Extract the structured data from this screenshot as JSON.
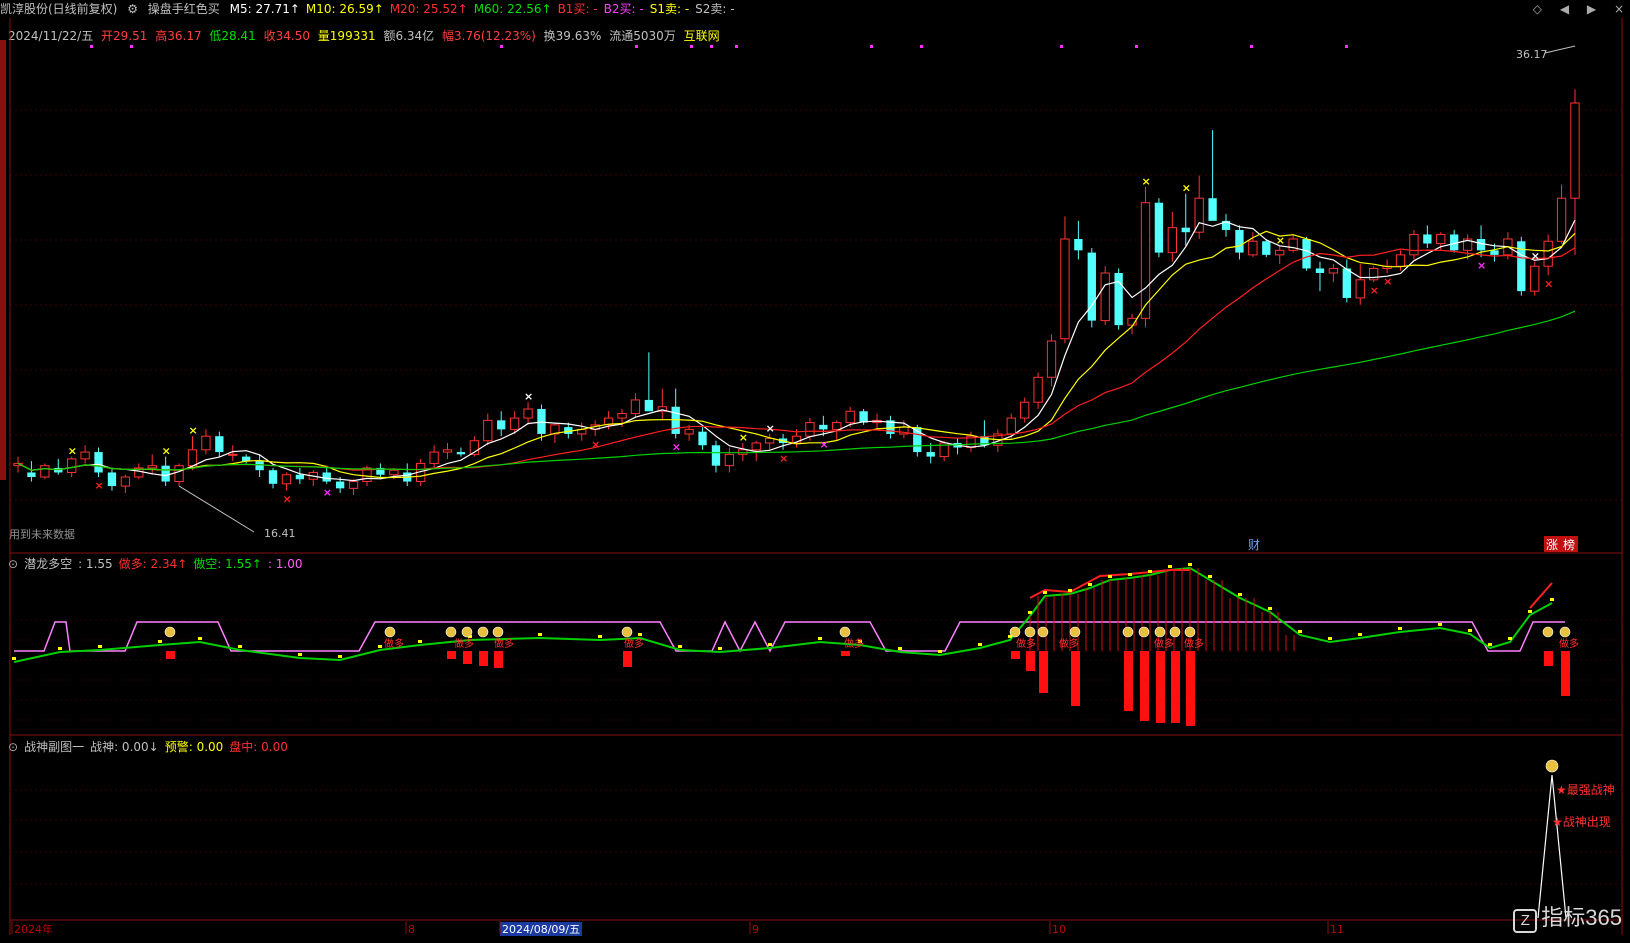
{
  "window": {
    "stock": "凯淳股份(日线前复权)",
    "indicator": "操盘手红色买",
    "ma_labels": [
      {
        "label": "M5: 27.71↑",
        "color": "#ffffff"
      },
      {
        "label": "M10: 26.59↑",
        "color": "#ffff00"
      },
      {
        "label": "M20: 25.52↑",
        "color": "#ff3030"
      },
      {
        "label": "M60: 22.56↑",
        "color": "#00e000"
      },
      {
        "label": "B1买: -",
        "color": "#ff3030"
      },
      {
        "label": "B2买: -",
        "color": "#ff40ff"
      },
      {
        "label": "S1卖: -",
        "color": "#ffff00"
      },
      {
        "label": "S2卖: -",
        "color": "#c0c0c0"
      }
    ],
    "controls": [
      "◇",
      "◀",
      "▶",
      "×"
    ]
  },
  "quote": {
    "date": "2024/11/22/五",
    "open": "开29.51",
    "high": "高36.17",
    "low": "低28.41",
    "close": "收34.50",
    "volume": "量199331",
    "amount": "额6.34亿",
    "change": "幅3.76(12.23%)",
    "turnover": "换39.63%",
    "float": "流通5030万",
    "sector": "互联网"
  },
  "main_chart": {
    "price_high_label": "36.17",
    "price_low_label": "16.41",
    "future_data_note": "用到未来数据",
    "marker_cai": "财",
    "marker_zhang": "涨",
    "marker_bang": "榜"
  },
  "ind1": {
    "name": "潜龙多空",
    "value": ": 1.55",
    "zuoduo": "做多: 2.34↑",
    "zuokong": "做空: 1.55↑",
    "extra": ": 1.00",
    "tag": "做多"
  },
  "ind2": {
    "name": "战神副图一",
    "zhanshen": "战神: 0.00↓",
    "yujing": "预警: 0.00",
    "panzhong": "盘中: 0.00",
    "label_strongest": "★最强战神",
    "label_appear": "★战神出现"
  },
  "time_axis": [
    {
      "label": "2024年",
      "highlight": false
    },
    {
      "label": "8",
      "highlight": false
    },
    {
      "label": "2024/08/09/五",
      "highlight": true
    },
    {
      "label": "9",
      "highlight": false
    },
    {
      "label": "10",
      "highlight": false
    },
    {
      "label": "11",
      "highlight": false
    }
  ],
  "logo": "指标365",
  "chart_data": {
    "type": "candlestick",
    "title": "凯淳股份(日线前复权)",
    "ylim": [
      15,
      37.5
    ],
    "annotations": [
      "36.17",
      "16.41"
    ],
    "series": [
      {
        "name": "K",
        "ohlc": [
          [
            18.5,
            18.9,
            18.2,
            18.6
          ],
          [
            18.2,
            18.7,
            17.8,
            18.0
          ],
          [
            18.0,
            18.6,
            17.9,
            18.5
          ],
          [
            18.4,
            18.8,
            18.1,
            18.2
          ],
          [
            18.2,
            18.9,
            18.0,
            18.8
          ],
          [
            18.8,
            19.4,
            18.6,
            19.1
          ],
          [
            19.1,
            19.3,
            18.0,
            18.2
          ],
          [
            18.2,
            18.4,
            17.4,
            17.6
          ],
          [
            17.6,
            18.1,
            17.3,
            18.0
          ],
          [
            18.0,
            18.6,
            17.9,
            18.4
          ],
          [
            18.4,
            19.0,
            18.1,
            18.5
          ],
          [
            18.5,
            18.9,
            17.6,
            17.8
          ],
          [
            17.8,
            18.6,
            17.6,
            18.5
          ],
          [
            18.5,
            19.8,
            18.3,
            19.2
          ],
          [
            19.2,
            20.1,
            19.0,
            19.8
          ],
          [
            19.8,
            20.0,
            18.9,
            19.1
          ],
          [
            19.0,
            19.4,
            18.7,
            19.0
          ],
          [
            18.9,
            19.0,
            18.6,
            18.7
          ],
          [
            18.7,
            19.0,
            18.0,
            18.3
          ],
          [
            18.3,
            18.4,
            17.5,
            17.7
          ],
          [
            17.7,
            18.2,
            17.4,
            18.1
          ],
          [
            18.1,
            18.4,
            17.7,
            17.9
          ],
          [
            17.9,
            18.3,
            17.6,
            18.2
          ],
          [
            18.2,
            18.5,
            17.7,
            17.8
          ],
          [
            17.8,
            18.0,
            17.3,
            17.5
          ],
          [
            17.5,
            17.9,
            17.2,
            17.8
          ],
          [
            17.8,
            18.5,
            17.6,
            18.4
          ],
          [
            18.4,
            18.6,
            17.9,
            18.1
          ],
          [
            18.1,
            18.4,
            17.9,
            18.3
          ],
          [
            18.2,
            18.6,
            17.6,
            17.8
          ],
          [
            17.8,
            18.8,
            17.6,
            18.6
          ],
          [
            18.6,
            19.4,
            18.4,
            19.1
          ],
          [
            19.1,
            19.5,
            18.8,
            19.2
          ],
          [
            19.1,
            19.3,
            18.9,
            19.0
          ],
          [
            19.0,
            19.8,
            18.9,
            19.6
          ],
          [
            19.6,
            20.8,
            19.4,
            20.5
          ],
          [
            20.5,
            20.9,
            19.8,
            20.1
          ],
          [
            20.1,
            20.9,
            19.9,
            20.6
          ],
          [
            20.6,
            21.3,
            20.3,
            21.0
          ],
          [
            21.0,
            21.2,
            19.6,
            19.9
          ],
          [
            19.9,
            20.4,
            19.5,
            20.3
          ],
          [
            20.2,
            20.4,
            19.7,
            19.9
          ],
          [
            19.9,
            20.4,
            19.6,
            20.1
          ],
          [
            20.1,
            20.5,
            19.8,
            20.3
          ],
          [
            20.3,
            20.9,
            20.1,
            20.6
          ],
          [
            20.6,
            21.0,
            20.2,
            20.8
          ],
          [
            20.8,
            21.7,
            20.6,
            21.4
          ],
          [
            21.4,
            23.5,
            21.0,
            20.9
          ],
          [
            20.9,
            21.9,
            20.5,
            21.1
          ],
          [
            21.1,
            21.9,
            19.7,
            19.9
          ],
          [
            19.9,
            20.3,
            19.6,
            20.1
          ],
          [
            20.0,
            20.2,
            19.2,
            19.4
          ],
          [
            19.4,
            19.6,
            18.2,
            18.5
          ],
          [
            18.5,
            19.3,
            18.2,
            19.0
          ],
          [
            19.0,
            19.5,
            18.7,
            19.2
          ],
          [
            19.2,
            19.6,
            18.7,
            19.5
          ],
          [
            19.5,
            19.9,
            19.2,
            19.7
          ],
          [
            19.7,
            19.9,
            19.2,
            19.5
          ],
          [
            19.5,
            20.1,
            19.3,
            19.8
          ],
          [
            19.8,
            20.6,
            19.6,
            20.4
          ],
          [
            20.3,
            20.7,
            19.8,
            20.1
          ],
          [
            20.1,
            20.5,
            19.6,
            20.4
          ],
          [
            20.4,
            21.1,
            20.2,
            20.9
          ],
          [
            20.9,
            21.0,
            20.3,
            20.4
          ],
          [
            20.4,
            20.8,
            20.1,
            20.5
          ],
          [
            20.5,
            20.7,
            19.7,
            19.9
          ],
          [
            19.9,
            20.5,
            19.7,
            20.2
          ],
          [
            20.2,
            20.3,
            18.9,
            19.1
          ],
          [
            19.1,
            19.5,
            18.6,
            18.9
          ],
          [
            18.9,
            19.6,
            18.7,
            19.5
          ],
          [
            19.5,
            19.7,
            19.0,
            19.3
          ],
          [
            19.3,
            20.0,
            19.1,
            19.8
          ],
          [
            19.8,
            20.5,
            19.3,
            19.4
          ],
          [
            19.4,
            20.1,
            19.1,
            19.9
          ],
          [
            19.9,
            20.8,
            19.7,
            20.6
          ],
          [
            20.6,
            21.5,
            20.4,
            21.3
          ],
          [
            21.3,
            22.6,
            21.0,
            22.4
          ],
          [
            22.4,
            24.3,
            22.0,
            24.0
          ],
          [
            24.1,
            29.5,
            23.9,
            28.5
          ],
          [
            28.5,
            29.3,
            27.6,
            28.0
          ],
          [
            27.9,
            28.1,
            24.6,
            24.9
          ],
          [
            24.9,
            27.3,
            24.7,
            27.0
          ],
          [
            27.0,
            27.2,
            24.5,
            24.7
          ],
          [
            24.7,
            25.2,
            24.3,
            25.0
          ],
          [
            25.0,
            30.8,
            24.6,
            30.1
          ],
          [
            30.1,
            30.3,
            27.7,
            27.9
          ],
          [
            27.9,
            29.7,
            27.5,
            29.0
          ],
          [
            29.0,
            30.5,
            28.2,
            28.8
          ],
          [
            28.8,
            31.3,
            28.5,
            30.3
          ],
          [
            30.3,
            33.3,
            29.9,
            29.3
          ],
          [
            29.3,
            29.6,
            28.6,
            28.9
          ],
          [
            28.9,
            29.1,
            27.6,
            27.9
          ],
          [
            27.8,
            28.8,
            27.7,
            28.4
          ],
          [
            28.4,
            28.5,
            27.7,
            27.8
          ],
          [
            27.8,
            28.2,
            27.4,
            28.0
          ],
          [
            28.0,
            28.7,
            27.9,
            28.5
          ],
          [
            28.5,
            28.6,
            27.1,
            27.2
          ],
          [
            27.2,
            27.5,
            26.2,
            27.0
          ],
          [
            27.0,
            27.4,
            26.6,
            27.2
          ],
          [
            27.2,
            27.6,
            25.7,
            25.9
          ],
          [
            25.9,
            27.4,
            25.6,
            26.7
          ],
          [
            26.7,
            27.3,
            26.6,
            27.2
          ],
          [
            27.2,
            27.6,
            27.0,
            27.3
          ],
          [
            27.3,
            28.0,
            27.1,
            27.8
          ],
          [
            27.8,
            28.9,
            27.6,
            28.7
          ],
          [
            28.7,
            29.1,
            28.1,
            28.3
          ],
          [
            28.3,
            28.8,
            28.0,
            28.7
          ],
          [
            28.7,
            28.9,
            27.9,
            28.0
          ],
          [
            28.0,
            28.7,
            27.6,
            28.5
          ],
          [
            28.5,
            29.1,
            27.7,
            28.0
          ],
          [
            28.0,
            28.3,
            27.5,
            27.8
          ],
          [
            27.8,
            28.8,
            27.6,
            28.5
          ],
          [
            28.4,
            28.6,
            26.0,
            26.2
          ],
          [
            26.2,
            27.5,
            26.0,
            27.3
          ],
          [
            27.3,
            28.7,
            26.9,
            28.4
          ],
          [
            28.4,
            30.9,
            28.3,
            30.3
          ],
          [
            30.3,
            35.1,
            27.8,
            34.5
          ]
        ]
      }
    ]
  }
}
